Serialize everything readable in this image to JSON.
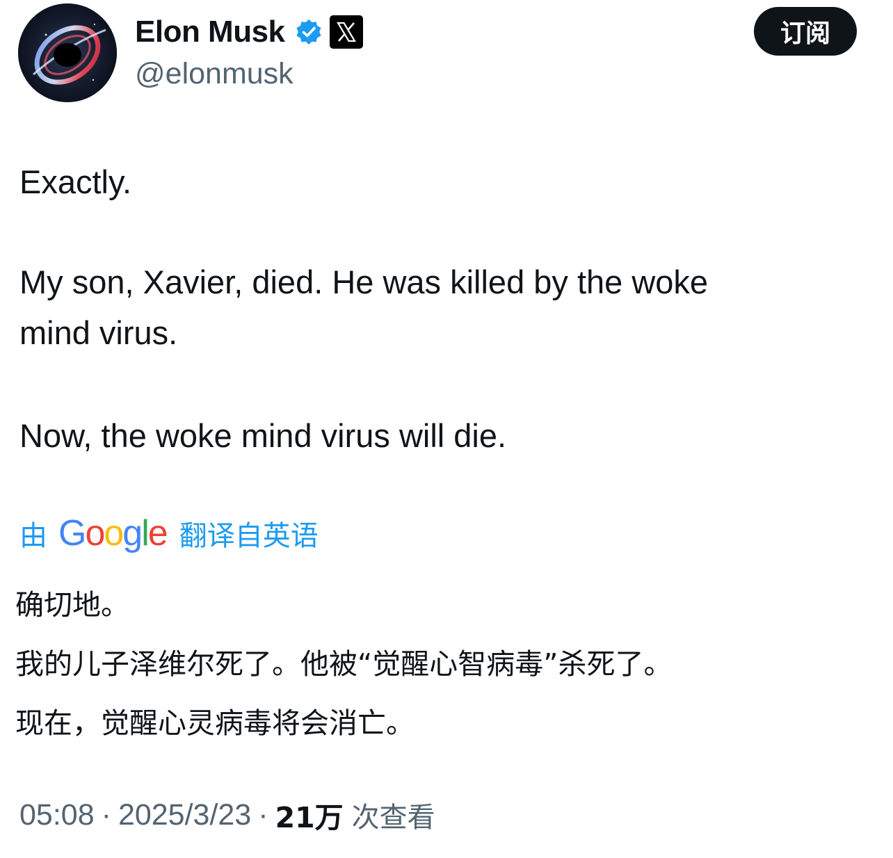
{
  "author": {
    "display_name": "Elon Musk",
    "handle": "@elonmusk",
    "avatar_icon": "black-hole-avatar-icon",
    "verified_icon": "verified-badge-icon",
    "affiliation_icon": "x-logo-icon"
  },
  "subscribe_label": "订阅",
  "tweet": {
    "lines": [
      "Exactly.",
      "My son, Xavier, died. He was killed by the woke",
      "mind virus.",
      "Now, the woke mind virus will die."
    ]
  },
  "translation": {
    "prefix": "由",
    "provider": "Google",
    "suffix": "翻译自英语",
    "lines": [
      "确切地。",
      "我的儿子泽维尔死了。他被“觉醒心智病毒”杀死了。",
      "现在，觉醒心灵病毒将会消亡。"
    ]
  },
  "meta": {
    "time": "05:08",
    "separator": "·",
    "date": "2025/3/23",
    "views_count": "21万",
    "views_label": "次查看"
  },
  "colors": {
    "accent": "#1d9bf0",
    "text": "#0f1419",
    "muted": "#536471"
  }
}
